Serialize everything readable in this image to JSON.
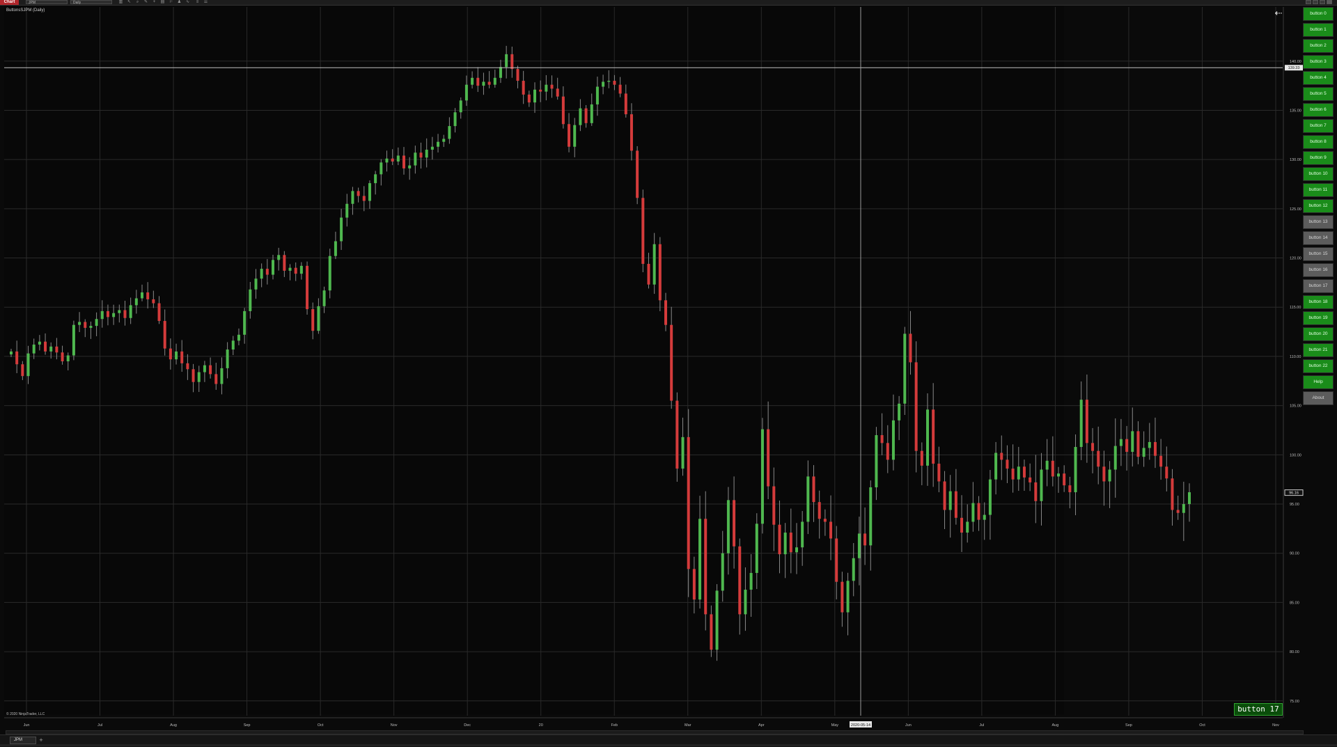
{
  "toolbar": {
    "chart_label": "Chart",
    "instrument": "JPM",
    "interval": "Daily",
    "icons": [
      "bar-type-icon",
      "pointer-icon",
      "zoom-icon",
      "draw-icon",
      "crosshair-icon",
      "properties-icon",
      "template-icon",
      "strategy-icon",
      "indicator-icon",
      "lines-icon",
      "list-icon"
    ]
  },
  "chart": {
    "label": "ButtonsSJPM (Daily)",
    "copyright": "© 2020 NinjaTrader, LLC",
    "crosshair_price": "139.33",
    "last_price": "96.16",
    "crosshair_date": "2020-05-14",
    "corner_badge": "button 17"
  },
  "chart_data": {
    "type": "candlestick",
    "ylim": [
      73.5,
      145.5
    ],
    "y_ticks": [
      {
        "label": "140.00",
        "v": 140
      },
      {
        "label": "135.00",
        "v": 135
      },
      {
        "label": "130.00",
        "v": 130
      },
      {
        "label": "125.00",
        "v": 125
      },
      {
        "label": "120.00",
        "v": 120
      },
      {
        "label": "115.00",
        "v": 115
      },
      {
        "label": "110.00",
        "v": 110
      },
      {
        "label": "105.00",
        "v": 105
      },
      {
        "label": "100.00",
        "v": 100
      },
      {
        "label": "95.00",
        "v": 95
      },
      {
        "label": "90.00",
        "v": 90
      },
      {
        "label": "85.00",
        "v": 85
      },
      {
        "label": "80.00",
        "v": 80
      },
      {
        "label": "75.00",
        "v": 75
      }
    ],
    "x_ticks": [
      "Jun",
      "Jul",
      "Aug",
      "Sep",
      "Oct",
      "Nov",
      "Dec",
      "20",
      "Feb",
      "Mar",
      "Apr",
      "May",
      "Jun",
      "Jul",
      "Aug",
      "Sep",
      "Oct",
      "Nov"
    ],
    "closes": [
      110.5,
      109.2,
      108.0,
      110.3,
      111.2,
      111.5,
      110.5,
      111.0,
      110.4,
      109.5,
      110.1,
      113.2,
      113.5,
      112.9,
      113.1,
      113.8,
      114.6,
      114.0,
      114.4,
      114.7,
      113.9,
      115.2,
      115.9,
      116.5,
      115.8,
      115.4,
      113.6,
      110.8,
      109.7,
      110.5,
      109.3,
      108.7,
      107.4,
      108.4,
      109.1,
      108.2,
      107.2,
      108.8,
      110.7,
      111.6,
      112.2,
      114.6,
      116.8,
      117.9,
      118.9,
      118.3,
      119.8,
      120.3,
      118.7,
      119.0,
      118.4,
      119.2,
      114.8,
      112.6,
      115.1,
      116.7,
      120.2,
      121.7,
      124.1,
      125.5,
      126.8,
      126.3,
      125.8,
      127.6,
      128.5,
      129.7,
      130.1,
      129.8,
      130.4,
      129.1,
      129.4,
      130.7,
      130.2,
      131.0,
      131.3,
      131.8,
      132.1,
      133.4,
      134.8,
      136.0,
      137.6,
      138.3,
      137.5,
      137.9,
      137.6,
      138.3,
      139.4,
      140.7,
      139.2,
      138.0,
      136.6,
      135.8,
      137.1,
      136.9,
      137.6,
      137.2,
      136.4,
      133.6,
      131.3,
      133.5,
      135.2,
      133.7,
      135.6,
      137.4,
      137.9,
      138.0,
      137.6,
      136.7,
      134.6,
      130.9,
      126.1,
      119.4,
      117.3,
      121.4,
      115.7,
      113.2,
      105.5,
      98.6,
      101.8,
      88.4,
      85.3,
      93.5,
      83.8,
      80.2,
      86.2,
      90.0,
      95.4,
      90.7,
      83.8,
      86.3,
      88.0,
      93.0,
      102.6,
      96.8,
      92.9,
      89.9,
      92.1,
      90.1,
      90.6,
      93.2,
      97.8,
      95.2,
      93.5,
      93.2,
      91.5,
      87.1,
      84.0,
      87.2,
      89.5,
      92.0,
      90.8,
      96.7,
      102.0,
      101.2,
      99.5,
      103.5,
      105.2,
      112.3,
      109.4,
      100.4,
      98.9,
      104.6,
      99.1,
      97.3,
      94.4,
      96.3,
      93.6,
      92.1,
      93.2,
      95.1,
      93.4,
      93.9,
      97.5,
      100.2,
      99.5,
      98.6,
      97.5,
      98.8,
      97.7,
      97.2,
      95.3,
      98.5,
      99.4,
      97.8,
      98.1,
      96.9,
      96.2,
      100.8,
      105.6,
      101.2,
      100.4,
      98.8,
      97.3,
      98.5,
      100.9,
      101.6,
      100.3,
      102.4,
      99.8,
      100.7,
      101.3,
      99.9,
      98.8,
      97.6,
      94.4,
      94.1,
      95.0,
      96.2
    ]
  },
  "side_buttons": [
    {
      "label": "button 0",
      "style": "green"
    },
    {
      "label": "button 1",
      "style": "green"
    },
    {
      "label": "button 2",
      "style": "green"
    },
    {
      "label": "button 3",
      "style": "green"
    },
    {
      "label": "button 4",
      "style": "green"
    },
    {
      "label": "button 5",
      "style": "green"
    },
    {
      "label": "button 6",
      "style": "green"
    },
    {
      "label": "button 7",
      "style": "green"
    },
    {
      "label": "button 8",
      "style": "green"
    },
    {
      "label": "button 9",
      "style": "green"
    },
    {
      "label": "button 10",
      "style": "green"
    },
    {
      "label": "button 11",
      "style": "green"
    },
    {
      "label": "button 12",
      "style": "green"
    },
    {
      "label": "button 13",
      "style": "gray"
    },
    {
      "label": "button 14",
      "style": "gray"
    },
    {
      "label": "button 15",
      "style": "gray"
    },
    {
      "label": "button 16",
      "style": "gray"
    },
    {
      "label": "button 17",
      "style": "gray"
    },
    {
      "label": "button 18",
      "style": "green"
    },
    {
      "label": "button 19",
      "style": "green"
    },
    {
      "label": "button 20",
      "style": "green"
    },
    {
      "label": "button 21",
      "style": "green"
    },
    {
      "label": "button 22",
      "style": "green"
    },
    {
      "label": "Help",
      "style": "green"
    },
    {
      "label": "About",
      "style": "gray"
    }
  ],
  "tabs": [
    {
      "label": "JPM"
    }
  ],
  "colors": {
    "up": "#4fb84f",
    "down": "#d43b3b",
    "grid": "#2a2a2a",
    "background": "#080808",
    "button_green": "#1a8c1a",
    "button_gray": "#5c5c5c"
  }
}
